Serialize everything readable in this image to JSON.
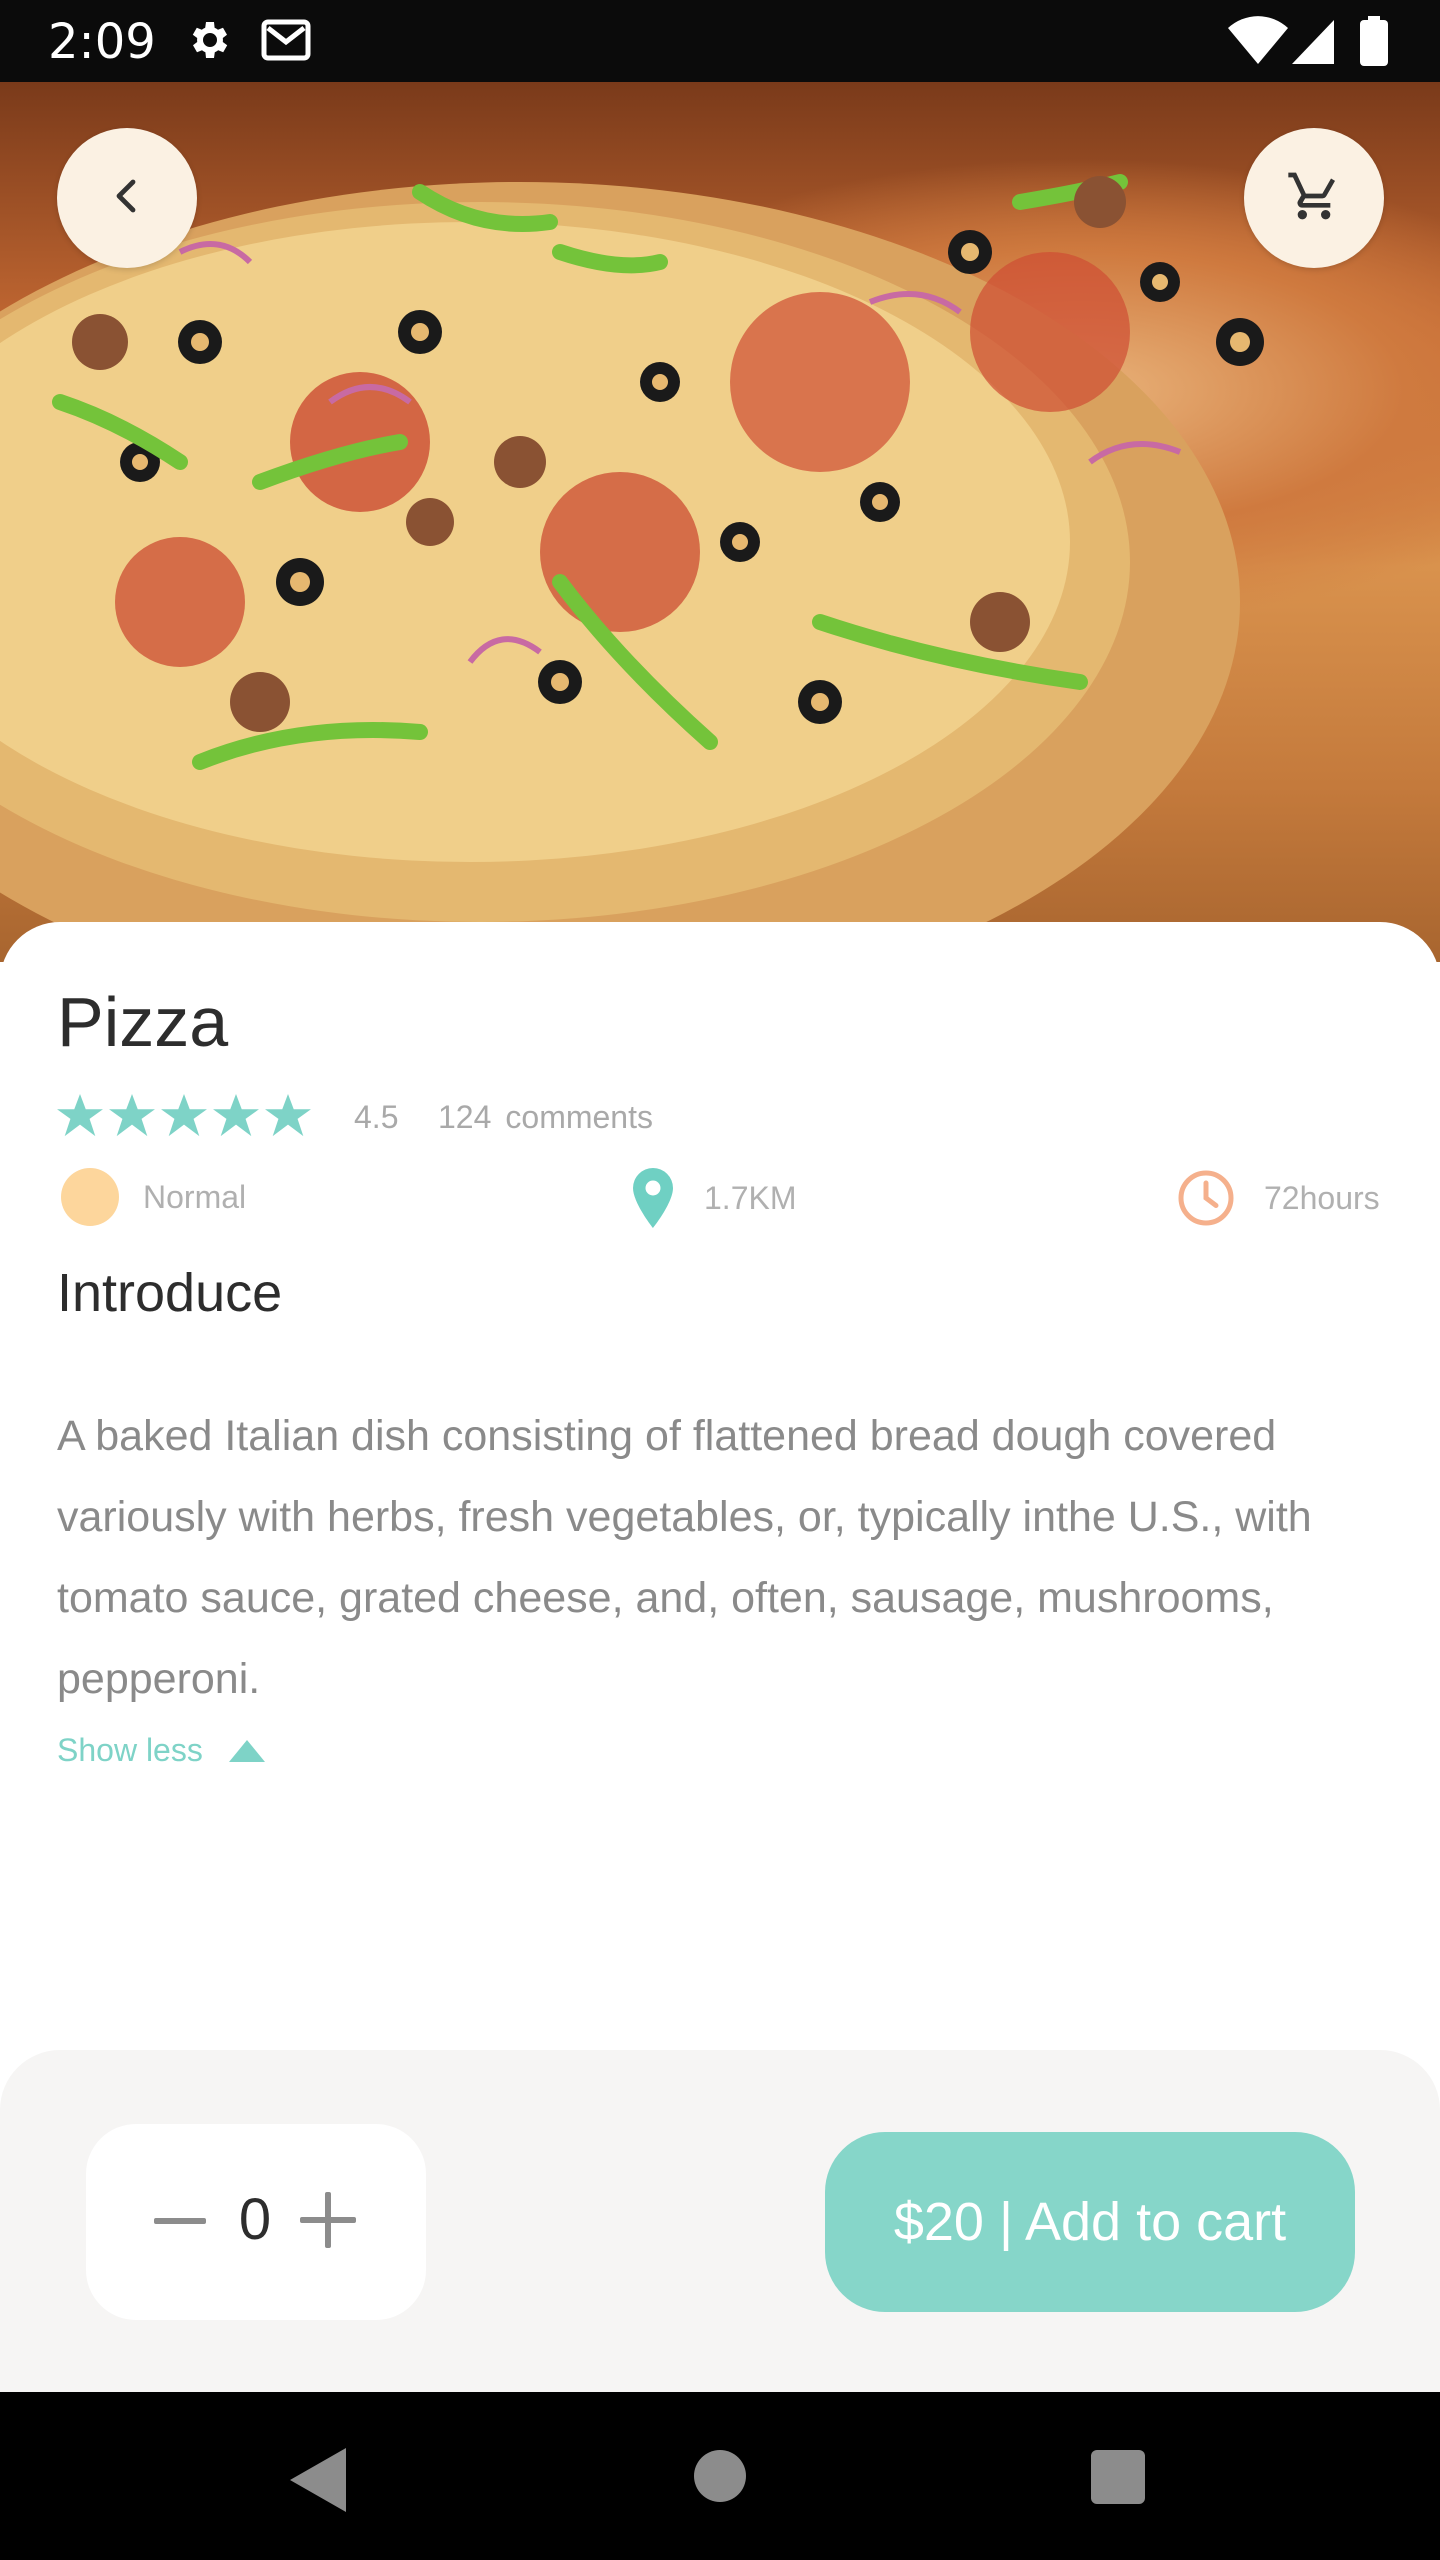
{
  "status_bar": {
    "time": "2:09",
    "icons": [
      "settings-icon",
      "gmail-icon",
      "wifi-icon",
      "signal-icon",
      "battery-icon"
    ]
  },
  "hero": {
    "image": "pizza-photo",
    "back_icon": "chevron-left-icon",
    "cart_icon": "cart-icon"
  },
  "product": {
    "name": "Pizza",
    "rating_value": "4.5",
    "stars": 5,
    "comments_count": "124",
    "comments_label": "comments",
    "meta": {
      "level": "Normal",
      "distance": "1.7KM",
      "time": "72hours"
    },
    "section_title": "Introduce",
    "description": "A baked Italian dish consisting of flattened bread dough covered variously with herbs, fresh vegetables, or, typically inthe U.S., with tomato sauce, grated cheese, and, often, sausage, mushrooms, pepperoni.",
    "show_less": "Show less"
  },
  "cart": {
    "quantity": "0",
    "add_button": "$20 | Add to cart"
  },
  "colors": {
    "accent": "#86d6c9",
    "star": "#7ed3c7",
    "level_dot": "#fdd69c",
    "clock": "#f5b08c"
  }
}
